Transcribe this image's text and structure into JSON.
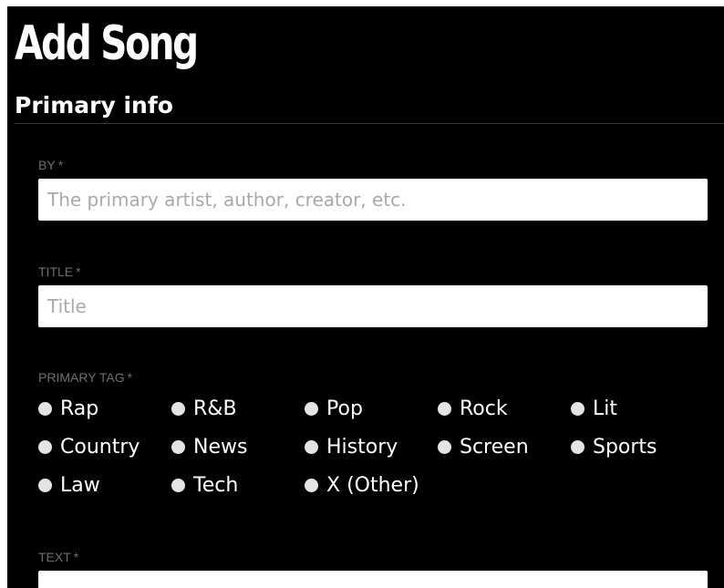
{
  "page": {
    "title": "Add Song"
  },
  "primary_info": {
    "heading": "Primary info",
    "by": {
      "label": "BY",
      "required_mark": "*",
      "placeholder": "The primary artist, author, creator, etc.",
      "value": ""
    },
    "title": {
      "label": "TITLE",
      "required_mark": "*",
      "placeholder": "Title",
      "value": ""
    },
    "primary_tag": {
      "label": "PRIMARY TAG",
      "required_mark": "*",
      "selected": null,
      "options": [
        "Rap",
        "R&B",
        "Pop",
        "Rock",
        "Lit",
        "Country",
        "News",
        "History",
        "Screen",
        "Sports",
        "Law",
        "Tech",
        "X (Other)"
      ]
    },
    "text": {
      "label": "TEXT",
      "required_mark": "*",
      "value": ""
    }
  },
  "colors": {
    "background": "#000000",
    "heading_text": "#ffffff",
    "field_label": "#6e6e6e",
    "input_background": "#ffffff",
    "placeholder": "#a9a9a9",
    "radio_dot": "#e4e4e4"
  }
}
